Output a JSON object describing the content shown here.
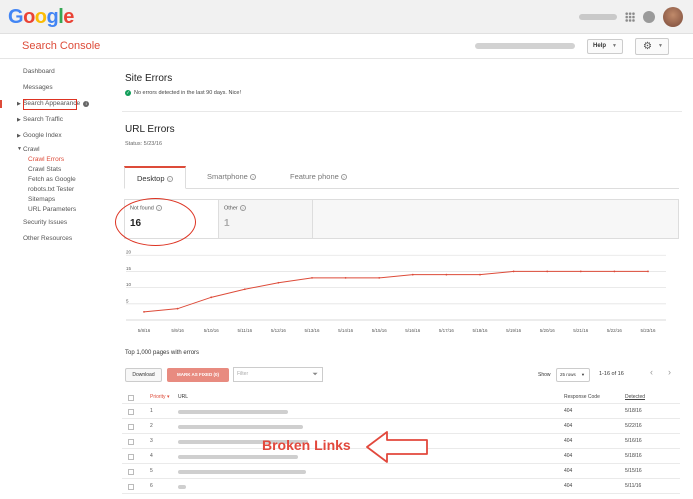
{
  "header": {
    "logo": "Google",
    "logo_colors": [
      "#4285f4",
      "#ea4335",
      "#fbbc05",
      "#4285f4",
      "#34a853",
      "#ea4335"
    ],
    "icons": [
      "apps-grid-icon",
      "notifications-icon",
      "avatar"
    ]
  },
  "subheader": {
    "title": "Search Console",
    "help_label": "Help",
    "settings_icon": "gear-icon"
  },
  "sidebar": {
    "items": [
      {
        "label": "Dashboard"
      },
      {
        "label": "Messages"
      },
      {
        "label": "Search Appearance"
      },
      {
        "label": "Search Traffic"
      },
      {
        "label": "Google Index"
      },
      {
        "label": "Crawl"
      }
    ],
    "crawl_sub": [
      "Crawl Errors",
      "Crawl Stats",
      "Fetch as Google",
      "robots.txt Tester",
      "Sitemaps",
      "URL Parameters"
    ],
    "bottom": [
      "Security Issues",
      "Other Resources"
    ]
  },
  "site_errors": {
    "title": "Site Errors",
    "status": "No errors detected in the last 90 days. Nice!"
  },
  "url_errors": {
    "title": "URL Errors",
    "status": "Status: 5/23/16",
    "tabs": [
      "Desktop",
      "Smartphone",
      "Feature phone"
    ],
    "boxes": [
      {
        "label": "Not found",
        "value": "16"
      },
      {
        "label": "Other",
        "value": "1"
      }
    ]
  },
  "chart_data": {
    "type": "line",
    "categories": [
      "5/8/16",
      "5/9/16",
      "5/10/16",
      "5/11/16",
      "5/12/16",
      "5/13/16",
      "5/14/16",
      "5/15/16",
      "5/16/16",
      "5/17/16",
      "5/18/16",
      "5/19/16",
      "5/20/16",
      "5/21/16",
      "5/22/16",
      "5/23/16"
    ],
    "series": [
      {
        "values": [
          2.5,
          3.5,
          7,
          9.5,
          11.5,
          13,
          13,
          13,
          14,
          14,
          14,
          15,
          15,
          15,
          15,
          15
        ]
      }
    ],
    "yticks": [
      "5",
      "10",
      "15",
      "20"
    ],
    "ylim": [
      0,
      21
    ],
    "color": "#dd4b39",
    "grid": true
  },
  "table": {
    "caption": "Top 1,000 pages with errors",
    "download_label": "Download",
    "mark_label": "MARK AS FIXED (0)",
    "filter_placeholder": "Filter",
    "show_label": "Show",
    "rows_select": "25 rows",
    "page_info": "1-16 of 16",
    "headers": {
      "priority": "Priority",
      "url": "URL",
      "response": "Response Code",
      "detected": "Detected"
    },
    "rows": [
      {
        "priority": "1",
        "code": "404",
        "date": "5/18/16"
      },
      {
        "priority": "2",
        "code": "404",
        "date": "5/22/16"
      },
      {
        "priority": "3",
        "code": "404",
        "date": "5/16/16"
      },
      {
        "priority": "4",
        "code": "404",
        "date": "5/18/16"
      },
      {
        "priority": "5",
        "code": "404",
        "date": "5/15/16"
      },
      {
        "priority": "6",
        "code": "404",
        "date": "5/11/16"
      }
    ]
  },
  "annotation": {
    "text": "Broken Links"
  }
}
